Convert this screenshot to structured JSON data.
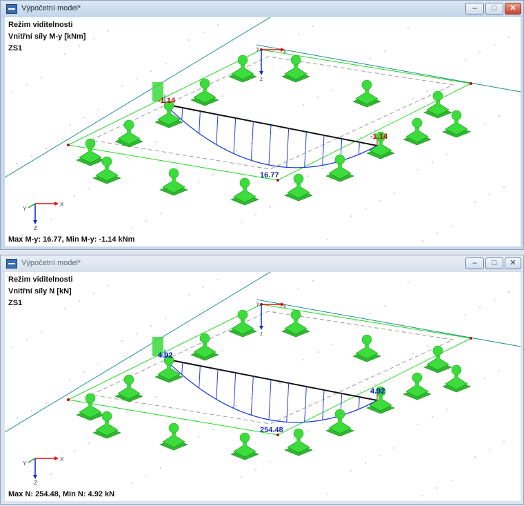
{
  "windows": [
    {
      "title": "Výpočetní model*",
      "header": [
        "Režim viditelnosti",
        "Vnitřní síly M-y [kNm]",
        "ZS1"
      ],
      "summary": "Max M-y: 16.77, Min M-y: -1.14 kNm",
      "labels": {
        "left_end": "-1.14",
        "right_end": "-1.14",
        "mid": "16.77"
      },
      "end_label_color": "#cc0000"
    },
    {
      "title": "Výpočetní model*",
      "header": [
        "Režim viditelnosti",
        "Vnitřní síly N [kN]",
        "ZS1"
      ],
      "summary": "Max N: 254.48, Min N: 4.92 kN",
      "labels": {
        "left_end": "4.92",
        "right_end": "4.92",
        "mid": "254.48"
      },
      "end_label_color": "#0000cc"
    }
  ],
  "buttons": {
    "minimize": "–",
    "maximize": "□",
    "close": "✕"
  },
  "axes": {
    "x": "x",
    "y": "y",
    "z": "z",
    "X": "X",
    "Y": "Y",
    "Z": "Z"
  },
  "colors": {
    "support": "#3bdc3b",
    "frame": "#22d622",
    "diagram": "#1e3fd8",
    "beam": "#111111",
    "grid_line": "#1f8f86",
    "axis_x": "#e01010"
  }
}
